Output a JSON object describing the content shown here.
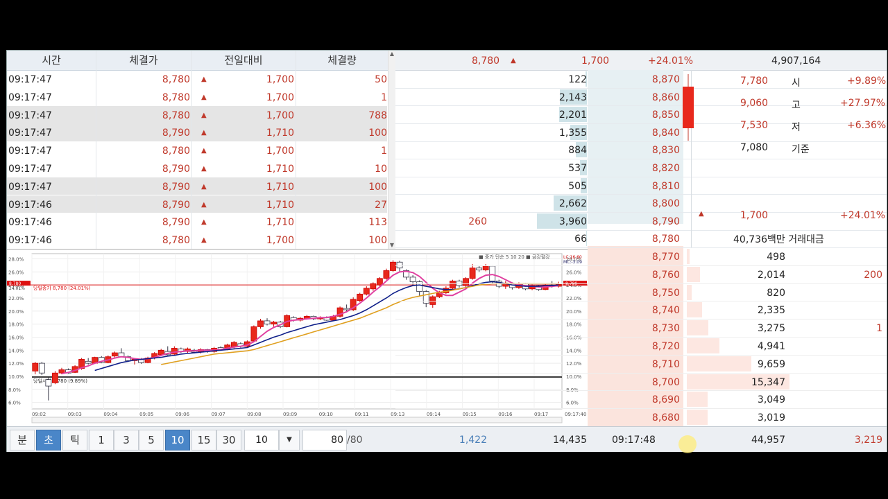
{
  "trades": {
    "headers": [
      "시간",
      "체결가",
      "전일대비",
      "체결량"
    ],
    "rows": [
      {
        "time": "09:17:47",
        "price": "8,780",
        "arrow": "▲",
        "diff": "1,700",
        "vol": "50",
        "alt": false
      },
      {
        "time": "09:17:47",
        "price": "8,780",
        "arrow": "▲",
        "diff": "1,700",
        "vol": "1",
        "alt": false
      },
      {
        "time": "09:17:47",
        "price": "8,780",
        "arrow": "▲",
        "diff": "1,700",
        "vol": "788",
        "alt": true
      },
      {
        "time": "09:17:47",
        "price": "8,790",
        "arrow": "▲",
        "diff": "1,710",
        "vol": "100",
        "alt": true
      },
      {
        "time": "09:17:47",
        "price": "8,780",
        "arrow": "▲",
        "diff": "1,700",
        "vol": "1",
        "alt": false
      },
      {
        "time": "09:17:47",
        "price": "8,790",
        "arrow": "▲",
        "diff": "1,710",
        "vol": "10",
        "alt": false
      },
      {
        "time": "09:17:47",
        "price": "8,790",
        "arrow": "▲",
        "diff": "1,710",
        "vol": "100",
        "alt": true
      },
      {
        "time": "09:17:46",
        "price": "8,790",
        "arrow": "▲",
        "diff": "1,710",
        "vol": "27",
        "alt": true
      },
      {
        "time": "09:17:46",
        "price": "8,790",
        "arrow": "▲",
        "diff": "1,710",
        "vol": "113",
        "alt": false
      },
      {
        "time": "09:17:46",
        "price": "8,780",
        "arrow": "▲",
        "diff": "1,700",
        "vol": "100",
        "alt": false
      }
    ]
  },
  "orderbook": {
    "top": {
      "price": "8,780",
      "arrow": "▲",
      "diff": "1,700",
      "rate": "+24.01%",
      "volume": "4,907,164"
    },
    "asks": [
      {
        "change": "",
        "qty": "122",
        "price": "8,870",
        "fill": 0.03
      },
      {
        "change": "",
        "qty": "2,143",
        "price": "8,860",
        "fill": 0.54
      },
      {
        "change": "",
        "qty": "2,201",
        "price": "8,850",
        "fill": 0.56
      },
      {
        "change": "",
        "qty": "1,355",
        "price": "8,840",
        "fill": 0.34
      },
      {
        "change": "",
        "qty": "884",
        "price": "8,830",
        "fill": 0.22
      },
      {
        "change": "",
        "qty": "537",
        "price": "8,820",
        "fill": 0.14
      },
      {
        "change": "",
        "qty": "505",
        "price": "8,810",
        "fill": 0.13
      },
      {
        "change": "",
        "qty": "2,662",
        "price": "8,800",
        "fill": 0.67
      },
      {
        "change": "260",
        "qty": "3,960",
        "price": "8,790",
        "fill": 1.0
      },
      {
        "change": "",
        "qty": "66",
        "price": "8,780",
        "fill": 0.02
      }
    ],
    "bids": [
      {
        "price": "8,770",
        "qty": "498",
        "change": "",
        "fill": 0.03
      },
      {
        "price": "8,760",
        "qty": "2,014",
        "change": "200",
        "fill": 0.13
      },
      {
        "price": "8,750",
        "qty": "820",
        "change": "",
        "fill": 0.05
      },
      {
        "price": "8,740",
        "qty": "2,335",
        "change": "",
        "fill": 0.15
      },
      {
        "price": "8,730",
        "qty": "3,275",
        "change": "1",
        "fill": 0.21
      },
      {
        "price": "8,720",
        "qty": "4,941",
        "change": "",
        "fill": 0.32
      },
      {
        "price": "8,710",
        "qty": "9,659",
        "change": "",
        "fill": 0.63
      },
      {
        "price": "8,700",
        "qty": "15,347",
        "change": "",
        "fill": 1.0
      },
      {
        "price": "8,690",
        "qty": "3,049",
        "change": "",
        "fill": 0.2
      },
      {
        "price": "8,680",
        "qty": "3,019",
        "change": "",
        "fill": 0.2
      }
    ],
    "info": {
      "open": {
        "value": "7,780",
        "label": "시",
        "rate": "+9.89%"
      },
      "high": {
        "value": "9,060",
        "label": "고",
        "rate": "+27.97%"
      },
      "low": {
        "value": "7,530",
        "label": "저",
        "rate": "+6.36%"
      },
      "base": {
        "value": "7,080",
        "label": "기준"
      },
      "diff": {
        "arrow": "▲",
        "value": "1,700",
        "rate": "+24.01%"
      },
      "amount": "40,736백만 거래대금"
    }
  },
  "chart_data": {
    "type": "candlestick",
    "legend": "■ 중가 단순 5 10 20 ■ 금강혈강",
    "right_top": [
      "LC:16.60",
      "MC:-3.09"
    ],
    "current_label": "8,780",
    "current_pct": "24.01%",
    "current_note": "당일종가 8,780 (24.01%)",
    "open_note": "당일시가 7,780 (9.89%)",
    "yticks": [
      "28.0%",
      "26.0%",
      "24.0%",
      "22.0%",
      "20.0%",
      "18.0%",
      "16.0%",
      "14.0%",
      "12.0%",
      "10.0%",
      "8.0%",
      "6.0%"
    ],
    "xticks": [
      "09:02",
      "09:03",
      "09:04",
      "09:05",
      "09:06",
      "09:07",
      "09:08",
      "09:09",
      "09:10",
      "09:11",
      "09:13",
      "09:14",
      "09:15",
      "09:16",
      "09:17"
    ],
    "last_time": "09:17:40",
    "ylim": [
      5.0,
      28.8
    ],
    "current_value": 24.01,
    "open_value": 9.89,
    "candles": [
      {
        "o": 10.8,
        "c": 12.0,
        "h": 12.2,
        "l": 10.3
      },
      {
        "o": 12.0,
        "c": 10.5,
        "h": 12.2,
        "l": 10.2
      },
      {
        "o": 9.5,
        "c": 8.5,
        "h": 9.8,
        "l": 6.3
      },
      {
        "o": 9.0,
        "c": 10.5,
        "h": 10.8,
        "l": 8.8
      },
      {
        "o": 10.5,
        "c": 11.0,
        "h": 11.3,
        "l": 10.3
      },
      {
        "o": 11.0,
        "c": 10.5,
        "h": 11.2,
        "l": 10.4
      },
      {
        "o": 10.6,
        "c": 11.5,
        "h": 11.7,
        "l": 10.5
      },
      {
        "o": 11.2,
        "c": 12.6,
        "h": 12.8,
        "l": 11.0
      },
      {
        "o": 12.3,
        "c": 12.0,
        "h": 12.8,
        "l": 11.8
      },
      {
        "o": 12.0,
        "c": 12.9,
        "h": 13.0,
        "l": 11.9
      },
      {
        "o": 12.9,
        "c": 12.1,
        "h": 13.1,
        "l": 12.0
      },
      {
        "o": 12.1,
        "c": 13.0,
        "h": 13.2,
        "l": 12.0
      },
      {
        "o": 13.1,
        "c": 13.6,
        "h": 13.8,
        "l": 12.9
      },
      {
        "o": 13.6,
        "c": 13.0,
        "h": 14.3,
        "l": 12.9
      },
      {
        "o": 13.0,
        "c": 12.4,
        "h": 13.2,
        "l": 12.2
      },
      {
        "o": 12.4,
        "c": 12.6,
        "h": 12.8,
        "l": 11.8
      },
      {
        "o": 12.6,
        "c": 12.1,
        "h": 12.8,
        "l": 11.9
      },
      {
        "o": 12.1,
        "c": 12.8,
        "h": 13.0,
        "l": 12.0
      },
      {
        "o": 12.8,
        "c": 13.5,
        "h": 13.7,
        "l": 12.6
      },
      {
        "o": 13.3,
        "c": 14.0,
        "h": 14.2,
        "l": 13.1
      },
      {
        "o": 13.8,
        "c": 13.3,
        "h": 14.6,
        "l": 13.2
      },
      {
        "o": 13.4,
        "c": 14.3,
        "h": 14.6,
        "l": 13.3
      },
      {
        "o": 14.2,
        "c": 13.8,
        "h": 14.4,
        "l": 13.6
      },
      {
        "o": 13.8,
        "c": 14.2,
        "h": 14.4,
        "l": 13.6
      },
      {
        "o": 14.0,
        "c": 13.7,
        "h": 14.2,
        "l": 13.5
      },
      {
        "o": 13.7,
        "c": 14.1,
        "h": 14.3,
        "l": 13.5
      },
      {
        "o": 14.1,
        "c": 13.8,
        "h": 14.2,
        "l": 13.6
      },
      {
        "o": 13.8,
        "c": 14.3,
        "h": 14.5,
        "l": 13.6
      },
      {
        "o": 14.4,
        "c": 14.1,
        "h": 14.6,
        "l": 13.9
      },
      {
        "o": 14.1,
        "c": 14.8,
        "h": 15.0,
        "l": 14.0
      },
      {
        "o": 14.5,
        "c": 15.2,
        "h": 15.4,
        "l": 14.3
      },
      {
        "o": 15.0,
        "c": 14.6,
        "h": 15.2,
        "l": 14.4
      },
      {
        "o": 14.6,
        "c": 15.3,
        "h": 15.5,
        "l": 14.5
      },
      {
        "o": 15.4,
        "c": 17.6,
        "h": 17.8,
        "l": 15.2
      },
      {
        "o": 17.6,
        "c": 18.5,
        "h": 18.8,
        "l": 17.3
      },
      {
        "o": 18.5,
        "c": 18.0,
        "h": 18.9,
        "l": 17.8
      },
      {
        "o": 18.0,
        "c": 18.3,
        "h": 18.5,
        "l": 17.6
      },
      {
        "o": 18.3,
        "c": 17.6,
        "h": 18.5,
        "l": 17.4
      },
      {
        "o": 17.6,
        "c": 19.3,
        "h": 19.5,
        "l": 17.5
      },
      {
        "o": 19.0,
        "c": 18.6,
        "h": 19.2,
        "l": 18.4
      },
      {
        "o": 18.6,
        "c": 18.9,
        "h": 19.1,
        "l": 18.4
      },
      {
        "o": 18.8,
        "c": 19.2,
        "h": 19.4,
        "l": 18.7
      },
      {
        "o": 19.2,
        "c": 18.8,
        "h": 19.3,
        "l": 18.6
      },
      {
        "o": 18.8,
        "c": 19.0,
        "h": 19.2,
        "l": 18.6
      },
      {
        "o": 19.0,
        "c": 18.6,
        "h": 19.2,
        "l": 18.5
      },
      {
        "o": 18.6,
        "c": 19.2,
        "h": 19.4,
        "l": 18.5
      },
      {
        "o": 19.2,
        "c": 20.5,
        "h": 20.7,
        "l": 19.0
      },
      {
        "o": 20.4,
        "c": 20.2,
        "h": 21.0,
        "l": 19.8
      },
      {
        "o": 20.2,
        "c": 21.8,
        "h": 22.1,
        "l": 20.0
      },
      {
        "o": 21.6,
        "c": 22.6,
        "h": 22.8,
        "l": 21.4
      },
      {
        "o": 22.6,
        "c": 23.5,
        "h": 23.8,
        "l": 22.4
      },
      {
        "o": 23.4,
        "c": 24.2,
        "h": 24.4,
        "l": 23.1
      },
      {
        "o": 24.0,
        "c": 25.0,
        "h": 25.2,
        "l": 23.8
      },
      {
        "o": 25.0,
        "c": 26.2,
        "h": 26.5,
        "l": 24.8
      },
      {
        "o": 26.2,
        "c": 27.5,
        "h": 27.8,
        "l": 26.0
      },
      {
        "o": 27.5,
        "c": 26.6,
        "h": 27.7,
        "l": 26.0
      },
      {
        "o": 26.2,
        "c": 25.2,
        "h": 26.4,
        "l": 24.8
      },
      {
        "o": 25.2,
        "c": 24.5,
        "h": 25.5,
        "l": 24.0
      },
      {
        "o": 24.5,
        "c": 23.0,
        "h": 24.7,
        "l": 22.3
      },
      {
        "o": 23.0,
        "c": 21.2,
        "h": 23.2,
        "l": 20.6
      },
      {
        "o": 21.0,
        "c": 22.2,
        "h": 22.4,
        "l": 20.5
      },
      {
        "o": 22.2,
        "c": 22.8,
        "h": 23.1,
        "l": 22.0
      },
      {
        "o": 22.8,
        "c": 23.5,
        "h": 23.8,
        "l": 22.6
      },
      {
        "o": 23.5,
        "c": 24.6,
        "h": 24.8,
        "l": 23.3
      },
      {
        "o": 24.6,
        "c": 23.9,
        "h": 24.8,
        "l": 23.6
      },
      {
        "o": 23.9,
        "c": 25.0,
        "h": 25.2,
        "l": 23.7
      },
      {
        "o": 25.0,
        "c": 26.6,
        "h": 27.2,
        "l": 24.8
      },
      {
        "o": 26.6,
        "c": 26.3,
        "h": 26.9,
        "l": 26.0
      },
      {
        "o": 26.3,
        "c": 26.9,
        "h": 27.2,
        "l": 26.1
      },
      {
        "o": 26.9,
        "c": 24.6,
        "h": 27.0,
        "l": 24.3
      },
      {
        "o": 24.6,
        "c": 23.8,
        "h": 24.8,
        "l": 23.5
      },
      {
        "o": 23.8,
        "c": 24.3,
        "h": 24.6,
        "l": 23.4
      },
      {
        "o": 24.2,
        "c": 23.6,
        "h": 24.4,
        "l": 23.3
      },
      {
        "o": 23.6,
        "c": 24.2,
        "h": 24.4,
        "l": 23.4
      },
      {
        "o": 24.2,
        "c": 23.4,
        "h": 24.3,
        "l": 23.2
      },
      {
        "o": 23.4,
        "c": 23.9,
        "h": 24.1,
        "l": 23.2
      },
      {
        "o": 23.9,
        "c": 23.3,
        "h": 24.0,
        "l": 23.1
      },
      {
        "o": 23.3,
        "c": 24.0,
        "h": 24.2,
        "l": 23.2
      },
      {
        "o": 24.0,
        "c": 23.8,
        "h": 24.6,
        "l": 23.6
      },
      {
        "o": 23.8,
        "c": 24.1,
        "h": 24.5,
        "l": 23.6
      }
    ],
    "series": [
      {
        "color": "#e040a0",
        "values": [
          null,
          null,
          null,
          null,
          10.4,
          10.6,
          10.9,
          11.3,
          11.6,
          12.0,
          12.3,
          12.5,
          12.8,
          13.0,
          12.9,
          12.7,
          12.6,
          12.7,
          12.9,
          13.2,
          13.5,
          13.7,
          13.8,
          13.9,
          13.9,
          14.0,
          14.0,
          14.0,
          14.1,
          14.3,
          14.5,
          14.6,
          14.8,
          15.3,
          16.1,
          16.9,
          17.5,
          17.9,
          18.4,
          18.6,
          18.7,
          18.8,
          18.9,
          19.0,
          19.0,
          19.2,
          19.5,
          19.9,
          20.5,
          21.2,
          22.0,
          22.9,
          23.7,
          24.6,
          25.5,
          26.0,
          26.1,
          25.9,
          25.3,
          24.4,
          23.5,
          22.8,
          22.4,
          22.4,
          22.9,
          23.4,
          24.3,
          25.0,
          25.5,
          25.6,
          25.3,
          24.8,
          24.3,
          24.0,
          23.9,
          23.8,
          23.7,
          23.7,
          23.8,
          23.9
        ]
      },
      {
        "color": "#10208a",
        "values": [
          null,
          null,
          null,
          null,
          null,
          null,
          null,
          null,
          null,
          10.9,
          11.2,
          11.5,
          11.8,
          12.1,
          12.3,
          12.5,
          12.6,
          12.7,
          12.8,
          12.9,
          13.1,
          13.2,
          13.4,
          13.5,
          13.6,
          13.7,
          13.8,
          13.9,
          14.0,
          14.1,
          14.2,
          14.3,
          14.4,
          14.8,
          15.2,
          15.6,
          16.0,
          16.3,
          16.7,
          17.0,
          17.3,
          17.6,
          17.9,
          18.1,
          18.3,
          18.5,
          18.7,
          19.0,
          19.3,
          19.7,
          20.2,
          20.8,
          21.4,
          22.0,
          22.7,
          23.2,
          23.6,
          23.9,
          24.0,
          23.8,
          23.6,
          23.4,
          23.3,
          23.3,
          23.4,
          23.6,
          23.9,
          24.2,
          24.4,
          24.5,
          24.4,
          24.2,
          24.0,
          23.9,
          23.8,
          23.8,
          23.8,
          23.9,
          23.9,
          24.0
        ]
      },
      {
        "color": "#e0a020",
        "values": [
          null,
          null,
          null,
          null,
          null,
          null,
          null,
          null,
          null,
          null,
          null,
          null,
          null,
          null,
          null,
          null,
          null,
          null,
          null,
          11.8,
          12.0,
          12.2,
          12.4,
          12.6,
          12.8,
          13.0,
          13.2,
          13.4,
          13.5,
          13.6,
          13.7,
          13.8,
          13.9,
          14.1,
          14.4,
          14.7,
          15.0,
          15.3,
          15.6,
          15.9,
          16.2,
          16.5,
          16.8,
          17.1,
          17.4,
          17.7,
          18.0,
          18.3,
          18.6,
          18.9,
          19.3,
          19.7,
          20.1,
          20.5,
          21.0,
          21.4,
          21.8,
          22.1,
          22.3,
          22.5,
          22.7,
          22.9,
          23.0,
          23.2,
          23.4,
          23.6,
          23.8,
          24.0,
          24.1,
          24.2,
          24.2,
          24.2,
          24.2,
          24.2,
          24.2,
          24.2,
          24.2,
          24.2,
          24.2,
          24.2
        ]
      }
    ]
  },
  "bottom": {
    "buttons": [
      {
        "label": "분",
        "sel": false
      },
      {
        "label": "초",
        "sel": true
      },
      {
        "label": "틱",
        "sel": false
      },
      {
        "label": "1",
        "sel": false
      },
      {
        "label": "3",
        "sel": false
      },
      {
        "label": "5",
        "sel": false
      },
      {
        "label": "10",
        "sel": true
      },
      {
        "label": "15",
        "sel": false
      },
      {
        "label": "30",
        "sel": false
      }
    ],
    "select_value": "10",
    "count_value": "80",
    "count_total": "/80",
    "ask_change_total": "1,422",
    "ask_total": "14,435",
    "time": "09:17:48",
    "bid_total": "44,957",
    "bid_change_total": "3,219"
  }
}
